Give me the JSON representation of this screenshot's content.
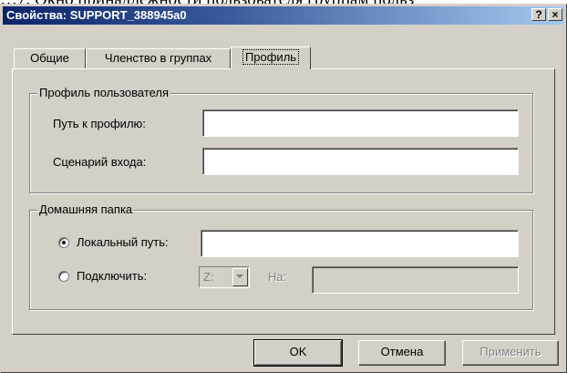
{
  "background_text": "…7. Окно принадлежности пользователя группам польз",
  "window": {
    "title": "Свойства: SUPPORT_388945a0",
    "help_button": "?",
    "close_button": "×"
  },
  "tabs": [
    {
      "label": "Общие",
      "active": false
    },
    {
      "label": "Членство в группах",
      "active": false
    },
    {
      "label": "Профиль",
      "active": true
    }
  ],
  "profile_group": {
    "title": "Профиль пользователя",
    "profile_path_label": "Путь к профилю:",
    "profile_path_value": "",
    "logon_script_label": "Сценарий входа:",
    "logon_script_value": ""
  },
  "home_group": {
    "title": "Домашняя папка",
    "local_path_label": "Локальный путь:",
    "local_path_value": "",
    "local_path_selected": true,
    "connect_label": "Подключить:",
    "drive_value": "Z:",
    "to_label": "На:",
    "to_value": ""
  },
  "buttons": {
    "ok": "OK",
    "cancel": "Отмена",
    "apply": "Применить"
  }
}
